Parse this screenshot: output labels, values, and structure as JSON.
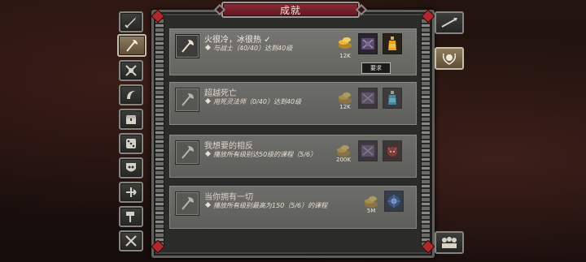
{
  "window": {
    "title": "成就"
  },
  "left_tabs": [
    {
      "icon": "sword-icon",
      "active": false
    },
    {
      "icon": "axe-weapon-icon",
      "active": true
    },
    {
      "icon": "warrior-emblem-icon",
      "active": false
    },
    {
      "icon": "crescent-hook-icon",
      "active": false
    },
    {
      "icon": "treasure-chest-icon",
      "active": false
    },
    {
      "icon": "dice-icon",
      "active": false
    },
    {
      "icon": "skull-shield-icon",
      "active": false
    },
    {
      "icon": "arrow-cross-icon",
      "active": false
    },
    {
      "icon": "hammer-icon",
      "active": false
    },
    {
      "icon": "crossed-weapons-icon",
      "active": false
    }
  ],
  "right_tabs": [
    {
      "icon": "spear-icon",
      "active": false
    },
    {
      "icon": "laurel-badge-icon",
      "active": true
    },
    {
      "icon": "party-group-icon",
      "active": false
    }
  ],
  "achievements": [
    {
      "name": "火很冷，冰很热",
      "completed_mark": "✓",
      "requirement": "与战士（40/40）达到40级",
      "completed": true,
      "gold": "12K",
      "rewards": [
        "rune-chest-icon",
        "potion-icon"
      ],
      "button": "要求"
    },
    {
      "name": "超越死亡",
      "requirement": "用死灵法师（0/40）达到40级",
      "completed": false,
      "gold": "12K",
      "rewards": [
        "rune-chest-icon",
        "mana-potion-icon"
      ]
    },
    {
      "name": "我想要的相反",
      "requirement": "播放所有级别达50级的课程（5/6）",
      "completed": false,
      "gold": "200K",
      "rewards": [
        "rune-chest-icon",
        "demon-mask-icon"
      ]
    },
    {
      "name": "当你拥有一切",
      "requirement": "播放所有级别最高为150（5/6）的课程",
      "completed": false,
      "gold": "5M",
      "rewards": [
        "arcane-orb-icon"
      ]
    }
  ],
  "colors": {
    "banner": "#8e2c35",
    "card_bg": "#6e6e6a",
    "frame": "#2b2b2a",
    "gold": "#e8b83a",
    "active_tab": "#8f7c5f"
  }
}
